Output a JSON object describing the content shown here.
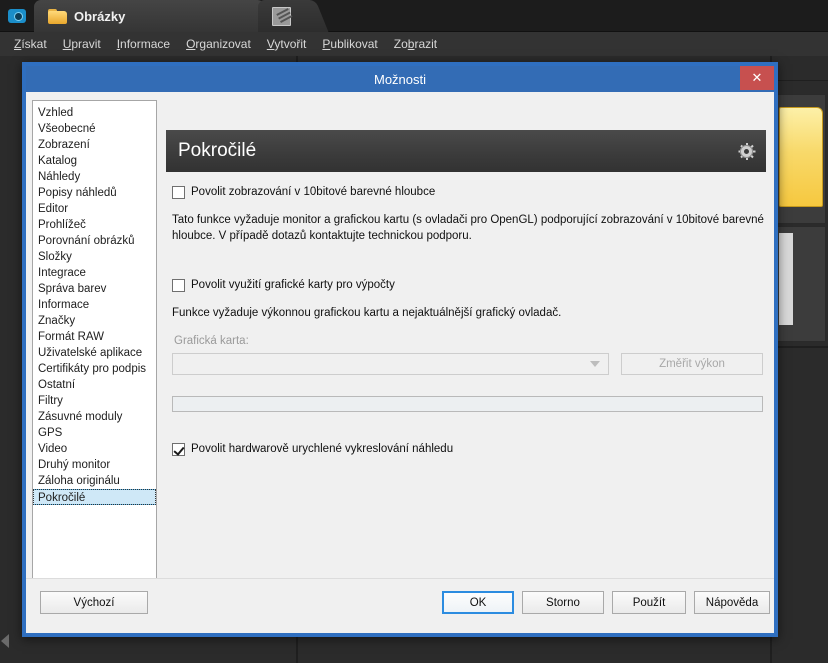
{
  "app": {
    "logo_icon": "camera-icon",
    "tabs": [
      {
        "label": "Obrázky",
        "icon": "folder-icon"
      },
      {
        "label": "",
        "icon": "edit-document-icon"
      }
    ],
    "menu": [
      {
        "label": "Získat",
        "accel": "Z"
      },
      {
        "label": "Upravit",
        "accel": "U"
      },
      {
        "label": "Informace",
        "accel": "I"
      },
      {
        "label": "Organizovat",
        "accel": "O"
      },
      {
        "label": "Vytvořit",
        "accel": "V"
      },
      {
        "label": "Publikovat",
        "accel": "P"
      },
      {
        "label": "Zobrazit",
        "accel": "b"
      }
    ]
  },
  "dialog": {
    "title": "Možnosti",
    "close_label": "✕",
    "sidebar": {
      "items": [
        "Vzhled",
        "Všeobecné",
        "Zobrazení",
        "Katalog",
        "Náhledy",
        "Popisy náhledů",
        "Editor",
        "Prohlížeč",
        "Porovnání obrázků",
        "Složky",
        "Integrace",
        "Správa barev",
        "Informace",
        "Značky",
        "Formát RAW",
        "Uživatelské aplikace",
        "Certifikáty pro podpis",
        "Ostatní",
        "Filtry",
        "Zásuvné moduly",
        "GPS",
        "Video",
        "Druhý monitor",
        "Záloha originálu",
        "Pokročilé"
      ],
      "selected": "Pokročilé"
    },
    "pane": {
      "header_title": "Pokročilé",
      "header_icon": "gear-icon",
      "checkbox_10bit": {
        "label": "Povolit zobrazování v 10bitové barevné hloubce",
        "checked": false
      },
      "description_10bit": "Tato funkce vyžaduje monitor a grafickou kartu (s ovladači pro OpenGL) podporující zobrazování v 10bitové barevné hloubce. V případě dotazů kontaktujte technickou podporu.",
      "checkbox_gpu": {
        "label": "Povolit využití grafické karty pro výpočty",
        "checked": false
      },
      "description_gpu": "Funkce vyžaduje výkonnou grafickou kartu a nejaktuálnější grafický ovladač.",
      "gpu_field_label": "Grafická karta:",
      "gpu_select_value": "",
      "measure_button": "Změřit výkon",
      "progress_value": "",
      "checkbox_hwaccel": {
        "label": "Povolit hardwarově urychlené vykreslování náhledu",
        "checked": true
      }
    },
    "footer": {
      "defaults": "Výchozí",
      "ok": "OK",
      "cancel": "Storno",
      "apply": "Použít",
      "help": "Nápověda"
    }
  },
  "colors": {
    "dialog_border": "#2f6fc0",
    "titlebar": "#336cb5",
    "close_red": "#c7504f",
    "selection": "#cfe8f7",
    "default_button_outline": "#2c8ce0",
    "app_background": "#2b2b2b"
  }
}
